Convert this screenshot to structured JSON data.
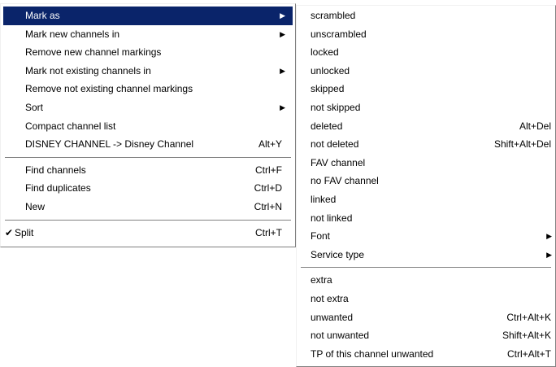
{
  "colors": {
    "highlight_bg": "#0a246a",
    "highlight_text": "#ffffff",
    "menu_bg": "#ffffff",
    "separator": "#808080"
  },
  "main_menu": {
    "items": [
      {
        "label": "Mark as",
        "submenu_arrow": "▶"
      },
      {
        "label": "Mark new channels in",
        "submenu_arrow": "▶"
      },
      {
        "label": "Remove new channel markings"
      },
      {
        "label": "Mark not existing channels in",
        "submenu_arrow": "▶"
      },
      {
        "label": "Remove not existing channel markings"
      },
      {
        "label": "Sort",
        "submenu_arrow": "▶"
      },
      {
        "label": "Compact channel list"
      },
      {
        "label": "DISNEY CHANNEL -> Disney Channel",
        "shortcut": "Alt+Y"
      },
      {
        "label": "Find channels",
        "shortcut": "Ctrl+F"
      },
      {
        "label": "Find duplicates",
        "shortcut": "Ctrl+D"
      },
      {
        "label": "New",
        "shortcut": "Ctrl+N"
      },
      {
        "label": "Split",
        "shortcut": "Ctrl+T",
        "check": "✔"
      }
    ]
  },
  "sub_menu": {
    "items": [
      {
        "label": "scrambled"
      },
      {
        "label": "unscrambled"
      },
      {
        "label": "locked"
      },
      {
        "label": "unlocked"
      },
      {
        "label": "skipped"
      },
      {
        "label": "not skipped"
      },
      {
        "label": "deleted",
        "shortcut": "Alt+Del"
      },
      {
        "label": "not deleted",
        "shortcut": "Shift+Alt+Del"
      },
      {
        "label": "FAV channel"
      },
      {
        "label": "no FAV channel"
      },
      {
        "label": "linked"
      },
      {
        "label": "not linked"
      },
      {
        "label": "Font",
        "submenu_arrow": "▶"
      },
      {
        "label": "Service type",
        "submenu_arrow": "▶"
      },
      {
        "label": "extra"
      },
      {
        "label": "not extra"
      },
      {
        "label": "unwanted",
        "shortcut": "Ctrl+Alt+K"
      },
      {
        "label": "not unwanted",
        "shortcut": "Shift+Alt+K"
      },
      {
        "label": "TP of this channel unwanted",
        "shortcut": "Ctrl+Alt+T"
      }
    ]
  }
}
